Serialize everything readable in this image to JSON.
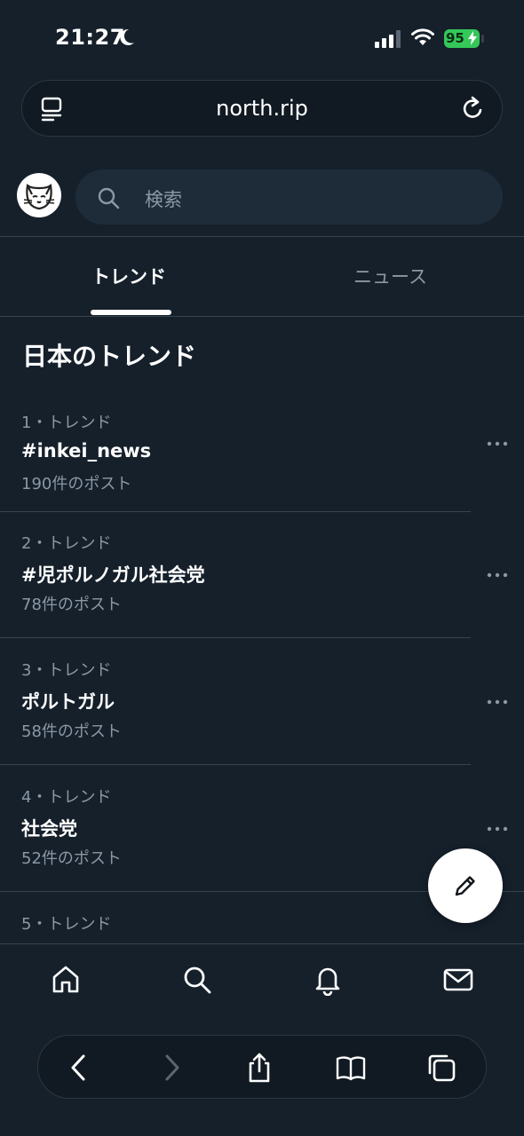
{
  "status_bar": {
    "time": "21:27",
    "battery": "95"
  },
  "browser": {
    "url": "north.rip"
  },
  "search": {
    "placeholder": "検索"
  },
  "tabs": [
    {
      "label": "トレンド",
      "active": true
    },
    {
      "label": "ニュース",
      "active": false
    }
  ],
  "section_title": "日本のトレンド",
  "trends": [
    {
      "meta": "1・トレンド",
      "name": "#inkei_news",
      "count": "190件のポスト"
    },
    {
      "meta": "2・トレンド",
      "name": "#児ポルノガル社会党",
      "count": "78件のポスト"
    },
    {
      "meta": "3・トレンド",
      "name": "ポルトガル",
      "count": "58件のポスト"
    },
    {
      "meta": "4・トレンド",
      "name": "社会党",
      "count": "52件のポスト"
    },
    {
      "meta": "5・トレンド",
      "name": "",
      "count": ""
    }
  ],
  "colors": {
    "background": "#15202b",
    "primary_text": "#ffffff",
    "secondary_text": "#8b98a5",
    "divider": "#38444d",
    "battery": "#34c759"
  },
  "icons": {
    "status": [
      "moon-icon",
      "signal-icon",
      "wifi-icon",
      "battery-icon"
    ],
    "url_bar": [
      "reader-icon",
      "reload-icon"
    ],
    "bottom_nav": [
      "home-icon",
      "search-icon",
      "bell-icon",
      "mail-icon"
    ],
    "browser_toolbar": [
      "back-icon",
      "forward-icon",
      "share-icon",
      "bookmarks-icon",
      "tabs-icon"
    ],
    "compose": "pencil-icon"
  }
}
